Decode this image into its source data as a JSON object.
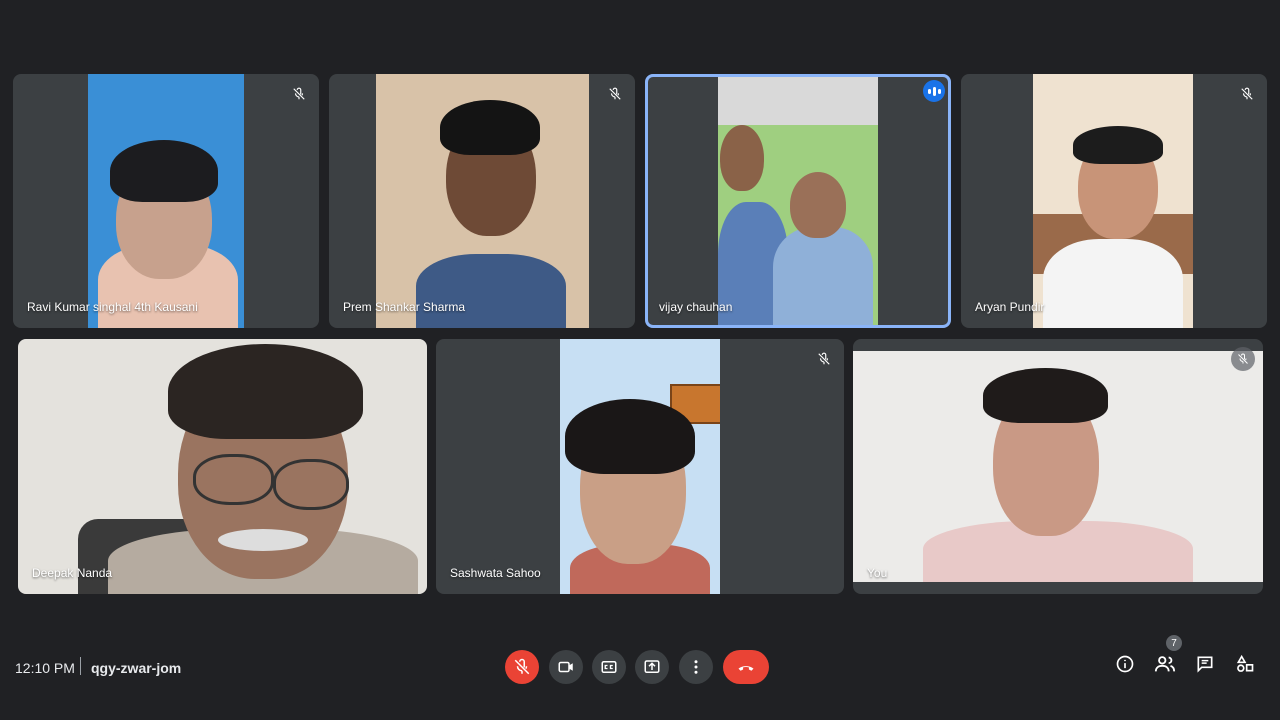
{
  "participants": [
    {
      "name": "Ravi Kumar singhal 4th Kausani",
      "muted": true
    },
    {
      "name": "Prem Shankar Sharma",
      "muted": true
    },
    {
      "name": "vijay chauhan",
      "muted": false,
      "speaking": true
    },
    {
      "name": "Aryan Pundir",
      "muted": true
    },
    {
      "name": "Deepak Nanda",
      "muted": false
    },
    {
      "name": "Sashwata Sahoo",
      "muted": true
    },
    {
      "name": "You",
      "muted": true
    }
  ],
  "meeting": {
    "time": "12:10 PM",
    "code": "qgy-zwar-jom"
  },
  "controls": [
    "mic-off-icon",
    "camera-icon",
    "captions-icon",
    "present-icon",
    "more-icon",
    "hang-up-icon"
  ],
  "right_controls": {
    "people_count": "7"
  },
  "colors": {
    "background": "#202124",
    "tile": "#3c4043",
    "accent": "#8ab4f8",
    "danger": "#ea4335"
  }
}
